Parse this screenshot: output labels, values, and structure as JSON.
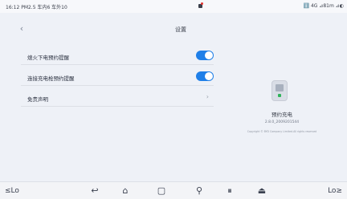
{
  "status_bar": {
    "left_text": "16:12 PM2.5 车内6 车外10",
    "right_text": "ℹ️  4G  ⊿81m ⊿◐"
  },
  "settings": {
    "title": "设置",
    "rows": [
      {
        "label": "熄火下电预约提醒",
        "toggle_on": true
      },
      {
        "label": "连接充电枪预约提醒",
        "toggle_on": true
      },
      {
        "label": "免责声明",
        "chevron": "›"
      }
    ]
  },
  "app_info": {
    "name": "预约充电",
    "version": "2.8.0_2009201544",
    "copyright": "Copyright © BYD Company Limited.All rights reserved"
  },
  "navbar": {
    "left_label": "Lo",
    "right_label": "Lo",
    "back_glyph": "↩",
    "home_glyph": "⌂",
    "recent_glyph": "▢",
    "car_glyph": "⚲",
    "ac_glyph": "⏸",
    "seat_glyph": "⏏"
  },
  "colors": {
    "accent": "#1f7fe8",
    "background": "#eef1f7",
    "status_dot": "#e2322f"
  }
}
